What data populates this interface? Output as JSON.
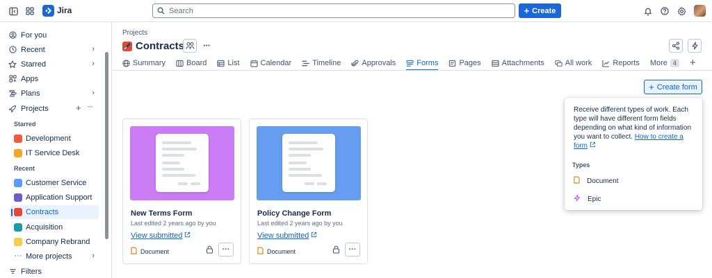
{
  "topbar": {
    "app_name": "Jira",
    "search_placeholder": "Search",
    "create_label": "Create"
  },
  "sidebar": {
    "items": [
      {
        "label": "For you"
      },
      {
        "label": "Recent"
      },
      {
        "label": "Starred"
      },
      {
        "label": "Apps"
      },
      {
        "label": "Plans"
      },
      {
        "label": "Projects"
      }
    ],
    "starred_label": "Starred",
    "starred_projects": [
      {
        "label": "Development",
        "color": "#f15b3c"
      },
      {
        "label": "IT Service Desk",
        "color": "#f5a623"
      }
    ],
    "recent_label": "Recent",
    "recent_projects": [
      {
        "label": "Customer Service",
        "color": "#579dff"
      },
      {
        "label": "Application Support",
        "color": "#6e5dc6"
      },
      {
        "label": "Contracts",
        "color": "#e34935"
      },
      {
        "label": "Acquisition",
        "color": "#1d9aaa"
      },
      {
        "label": "Company Rebrand",
        "color": "#f5cd47"
      }
    ],
    "more_projects": "More projects",
    "filters": "Filters"
  },
  "main": {
    "breadcrumb": "Projects",
    "title": "Contracts",
    "tabs": [
      {
        "label": "Summary"
      },
      {
        "label": "Board"
      },
      {
        "label": "List"
      },
      {
        "label": "Calendar"
      },
      {
        "label": "Timeline"
      },
      {
        "label": "Approvals"
      },
      {
        "label": "Forms"
      },
      {
        "label": "Pages"
      },
      {
        "label": "Attachments"
      },
      {
        "label": "All work"
      },
      {
        "label": "Reports"
      },
      {
        "label": "More"
      }
    ],
    "more_count": "4",
    "create_form": "Create form"
  },
  "cards": [
    {
      "title": "New Terms Form",
      "meta": "Last edited 2 years ago by you",
      "link": "View submitted",
      "type": "Document",
      "thumb_color": "#c97cf4"
    },
    {
      "title": "Policy Change Form",
      "meta": "Last edited 2 years ago by you",
      "link": "View submitted",
      "type": "Document",
      "thumb_color": "#669df1"
    }
  ],
  "popover": {
    "description": "Receive different types of work. Each type will have different form fields depending on what kind of information you want to collect.",
    "link": "How to create a form",
    "types_label": "Types",
    "types": [
      {
        "label": "Document"
      },
      {
        "label": "Epic"
      }
    ]
  },
  "colors": {
    "accent": "#0c66e4",
    "brand": "#1868db"
  }
}
